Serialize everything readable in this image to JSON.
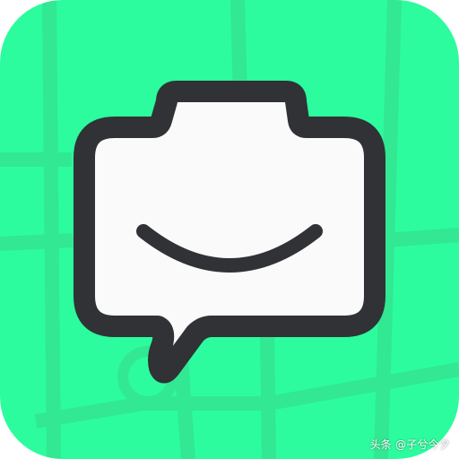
{
  "icon": {
    "name": "camera-chat-bubble-smile-icon",
    "background_color": "#2cfc9e",
    "map_line_color": "#32e892",
    "bubble_fill_color": "#fafafa",
    "outline_color": "#303236"
  },
  "watermark": {
    "text": "头条 @子兮今夕"
  }
}
